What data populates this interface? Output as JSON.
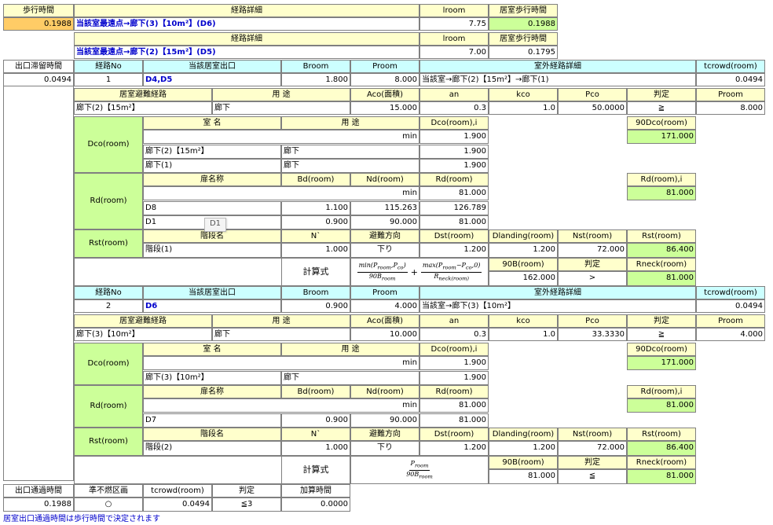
{
  "top": {
    "walk_time_label": "歩行時間",
    "walk_time_value": "0.1988",
    "route_detail_label": "経路詳細",
    "lroom_label": "lroom",
    "room_walk_label": "居室歩行時間",
    "route1": "当該室最遠点→廊下(3)【10m²】(D6)",
    "lroom1": "7.75",
    "walk1": "0.1988",
    "route2": "当該室最遠点→廊下(2)【15m²】(D5)",
    "lroom2": "7.00",
    "walk2": "0.1795"
  },
  "exit_stay": {
    "label": "出口滞留時間",
    "value": "0.0494"
  },
  "headers": {
    "route_no": "経路No",
    "room_exit": "当該居室出口",
    "broom": "Broom",
    "proom": "Proom",
    "outdoor": "室外経路詳細",
    "tcrowd": "tcrowd(room)",
    "evac_route": "居室避難経路",
    "usage": "用 途",
    "aco": "Aco(面積)",
    "an": "an",
    "kco": "kco",
    "pco": "Pco",
    "judge": "判定",
    "proom2": "Proom",
    "dco_label": "Dco(room)",
    "room_name": "室 名",
    "usage2": "用 途",
    "dcoi": "Dco(room),i",
    "dco90": "90Dco(room)",
    "rd_label": "Rd(room)",
    "door_name": "扉名称",
    "bd": "Bd(room)",
    "nd": "Nd(room)",
    "rd": "Rd(room)",
    "rdi": "Rd(room),i",
    "rst_label": "Rst(room)",
    "stair_name": "階段名",
    "nprime": "N`",
    "direction": "避難方向",
    "dst": "Dst(room)",
    "dlanding": "Dlanding(room)",
    "nst": "Nst(room)",
    "rst": "Rst(room)",
    "calc": "計算式",
    "b90": "90B(room)",
    "judge2": "判定",
    "rneck": "Rneck(room)",
    "min": "min"
  },
  "route1": {
    "no": "1",
    "exit": "D4,D5",
    "broom": "1.800",
    "proom": "8.000",
    "outdoor": "当該室→廊下(2)【15m²】→廊下(1)",
    "tcrowd": "0.0494",
    "evac_name": "廊下(2)【15m²】",
    "evac_usage": "廊下",
    "aco": "15.000",
    "an": "0.3",
    "kco": "1.0",
    "pco": "50.0000",
    "judge": "≧",
    "proom2": "8.000",
    "dco_min": "1.900",
    "dco90": "171.000",
    "dco_rows": [
      {
        "name": "廊下(2)【15m²】",
        "usage": "廊下",
        "val": "1.900"
      },
      {
        "name": "廊下(1)",
        "usage": "廊下",
        "val": "1.900"
      }
    ],
    "rd_min": "81.000",
    "rdi": "81.000",
    "rd_rows": [
      {
        "name": "D8",
        "bd": "1.100",
        "nd": "115.263",
        "rd": "126.789"
      },
      {
        "name": "D1",
        "bd": "0.900",
        "nd": "90.000",
        "rd": "81.000"
      }
    ],
    "stair": {
      "name": "階段(1)",
      "n": "1.000",
      "dir": "下り",
      "dst": "1.200",
      "dl": "1.200",
      "nst": "72.000",
      "rst": "86.400"
    },
    "b90": "162.000",
    "judge2": ">",
    "rneck": "81.000"
  },
  "route2": {
    "no": "2",
    "exit": "D6",
    "broom": "0.900",
    "proom": "4.000",
    "outdoor": "当該室→廊下(3)【10m²】",
    "tcrowd": "0.0494",
    "evac_name": "廊下(3)【10m²】",
    "evac_usage": "廊下",
    "aco": "10.000",
    "an": "0.3",
    "kco": "1.0",
    "pco": "33.3330",
    "judge": "≧",
    "proom2": "4.000",
    "dco_min": "1.900",
    "dco90": "171.000",
    "dco_rows": [
      {
        "name": "廊下(3)【10m²】",
        "usage": "廊下",
        "val": "1.900"
      }
    ],
    "rd_min": "81.000",
    "rdi": "81.000",
    "rd_rows": [
      {
        "name": "D7",
        "bd": "0.900",
        "nd": "90.000",
        "rd": "81.000"
      }
    ],
    "stair": {
      "name": "階段(2)",
      "n": "1.000",
      "dir": "下り",
      "dst": "1.200",
      "dl": "1.200",
      "nst": "72.000",
      "rst": "86.400"
    },
    "b90": "81.000",
    "judge2": "≦",
    "rneck": "81.000"
  },
  "exit_pass": {
    "label": "出口通過時間",
    "value": "0.1988",
    "semi_label": "準不燃区画",
    "semi_value": "○",
    "tcrowd_label": "tcrowd(room)",
    "tcrowd_value": "0.0494",
    "judge_label": "判定",
    "judge_value": "≦3",
    "add_label": "加算時間",
    "add_value": "0.0000"
  },
  "tooltip": "D1",
  "footer_note": "居室出口通過時間は歩行時間で決定されます"
}
